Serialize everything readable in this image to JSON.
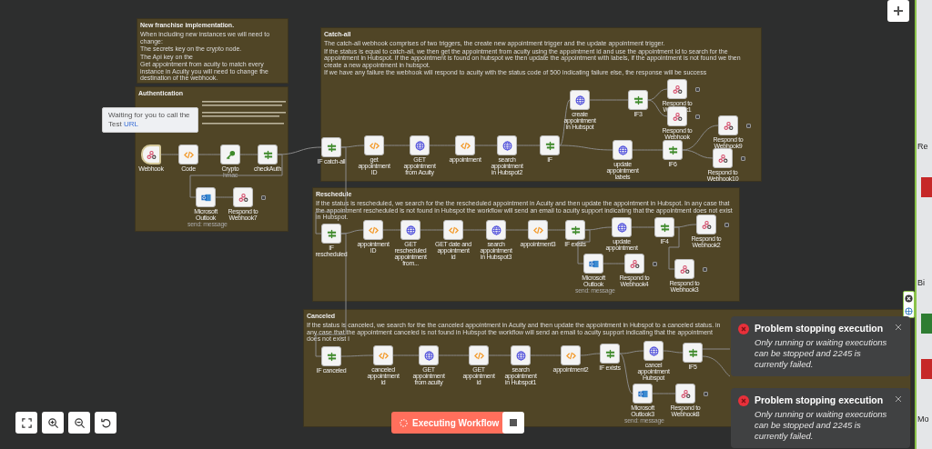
{
  "notes": [
    {
      "title": "New franchise implementation.",
      "paragraphs": [
        "When including new instances we will need to change:",
        "The secrets key on the crypto node.",
        "The Api key on the",
        "Get appointment from acuity to match every instance in Acuity you will need to change the destination of the webhook."
      ]
    },
    {
      "title": "Authentication"
    },
    {
      "title": "Catch-all",
      "paragraphs": [
        "The catch-all webhook comprises of two triggers, the create new appointment trigger and the update appointment trigger.",
        "If the status is equal to catch-all, we then get the appointment from acuity using the appointment id and use the appointment id to search for the appointment in Hubspot. If the appointment is found on hubspot we then update the appointment with labels, if the appointment is not found we then create a new appointment in hubspot.",
        "If we have any failure the webhook will respond to acuity with the status code of 500 indicating failure else, the response will be success"
      ]
    },
    {
      "title": "Reschedule",
      "paragraphs": [
        "If the status is rescheduled, we search for the the rescheduled appointment in Acuity and then update the appointment in Hubspot. In any case that the appointment rescheduled is not found in Hubspot the workflow will send an email to acuity support indicating that the appointment does not exist in Hubspot."
      ]
    },
    {
      "title": "Canceled",
      "paragraphs": [
        "If the status is canceled, we search for the the canceled appointment in Acuity and then update the appointment in Hubspot to a canceled status. in any case that the appointment canceled is not found in Hubspot the workflow will send an email to acuity support indicating that the appointment does not exist i"
      ]
    }
  ],
  "nodes": [
    {
      "label": "Webhook",
      "kind": "webhook",
      "waiting": true
    },
    {
      "label": "Code",
      "kind": "code",
      "waiting": false
    },
    {
      "label": "Crypto",
      "kind": "crypto",
      "subtitle": "hmac",
      "waiting": false
    },
    {
      "label": "checkAuth",
      "kind": "if",
      "waiting": false
    },
    {
      "label": "Microsoft Outlook",
      "kind": "outlook",
      "subtitle": "send: message",
      "waiting": false
    },
    {
      "label": "Respond to Webhook7",
      "kind": "webhook",
      "waiting": false
    },
    {
      "label": "IF catch-all",
      "kind": "if",
      "waiting": false
    },
    {
      "label": "get appointment ID",
      "kind": "code",
      "waiting": false
    },
    {
      "label": "GET appointment from Acuity",
      "kind": "http",
      "waiting": false
    },
    {
      "label": "appointment",
      "kind": "code",
      "waiting": false
    },
    {
      "label": "search appointment in Hubspot2",
      "kind": "http",
      "waiting": false
    },
    {
      "label": "IF",
      "kind": "if",
      "waiting": false
    },
    {
      "label": "create appointment in Hubspot",
      "kind": "http",
      "waiting": false
    },
    {
      "label": "IF3",
      "kind": "if",
      "waiting": false
    },
    {
      "label": "Respond to Webhook1",
      "kind": "webhook",
      "waiting": false
    },
    {
      "label": "Respond to Webhook",
      "kind": "webhook",
      "waiting": false
    },
    {
      "label": "update appointment labels",
      "kind": "http",
      "waiting": false
    },
    {
      "label": "IF6",
      "kind": "if",
      "waiting": false
    },
    {
      "label": "Respond to Webhook9",
      "kind": "webhook",
      "waiting": false
    },
    {
      "label": "Respond to Webhook10",
      "kind": "webhook",
      "waiting": false
    },
    {
      "label": "IF rescheduled",
      "kind": "if",
      "waiting": false
    },
    {
      "label": "appointment ID",
      "kind": "code",
      "waiting": false
    },
    {
      "label": "GET rescheduled appointment from...",
      "kind": "http",
      "waiting": false
    },
    {
      "label": "GET date and appointment id",
      "kind": "code",
      "waiting": false
    },
    {
      "label": "search appointment in Hubspot3",
      "kind": "http",
      "waiting": false
    },
    {
      "label": "appointment3",
      "kind": "code",
      "waiting": false
    },
    {
      "label": "IF exists",
      "kind": "if",
      "waiting": false
    },
    {
      "label": "update appointment",
      "kind": "http",
      "waiting": false
    },
    {
      "label": "IF4",
      "kind": "if",
      "waiting": false
    },
    {
      "label": "Respond to Webhook2",
      "kind": "webhook",
      "waiting": false
    },
    {
      "label": "Microsoft Outlook",
      "kind": "outlook",
      "subtitle": "send: message",
      "waiting": false
    },
    {
      "label": "Respond to Webhook4",
      "kind": "webhook",
      "waiting": false
    },
    {
      "label": "Respond to Webhook3",
      "kind": "webhook",
      "waiting": false
    },
    {
      "label": "IF canceled",
      "kind": "if",
      "waiting": false
    },
    {
      "label": "canceled appointment id",
      "kind": "code",
      "waiting": false
    },
    {
      "label": "GET appointment from acuity",
      "kind": "http",
      "waiting": false
    },
    {
      "label": "GET appointment id",
      "kind": "code",
      "waiting": false
    },
    {
      "label": "search appointment in Hubspot1",
      "kind": "http",
      "waiting": false
    },
    {
      "label": "appointment2",
      "kind": "code",
      "waiting": false
    },
    {
      "label": "IF exists",
      "kind": "if",
      "waiting": false
    },
    {
      "label": "cancel appointment Hubspot",
      "kind": "http",
      "waiting": false
    },
    {
      "label": "IF5",
      "kind": "if",
      "waiting": false
    },
    {
      "label": "Microsoft Outlook3",
      "kind": "outlook",
      "subtitle": "send: message",
      "waiting": false
    },
    {
      "label": "Respond to Webhook8",
      "kind": "webhook",
      "waiting": false
    }
  ],
  "tooltip": {
    "text": "Waiting for you to call the Test",
    "link": "URL"
  },
  "toasts": [
    {
      "title": "Problem stopping execution",
      "message": "Only running or waiting executions can be stopped and 2245 is currently failed."
    },
    {
      "title": "Problem stopping execution",
      "message": "Only running or waiting executions can be stopped and 2245 is currently failed."
    }
  ],
  "execute_button": {
    "label": "Executing Workflow"
  },
  "desktop_labels": [
    "Re",
    "Bi",
    "Mo"
  ]
}
